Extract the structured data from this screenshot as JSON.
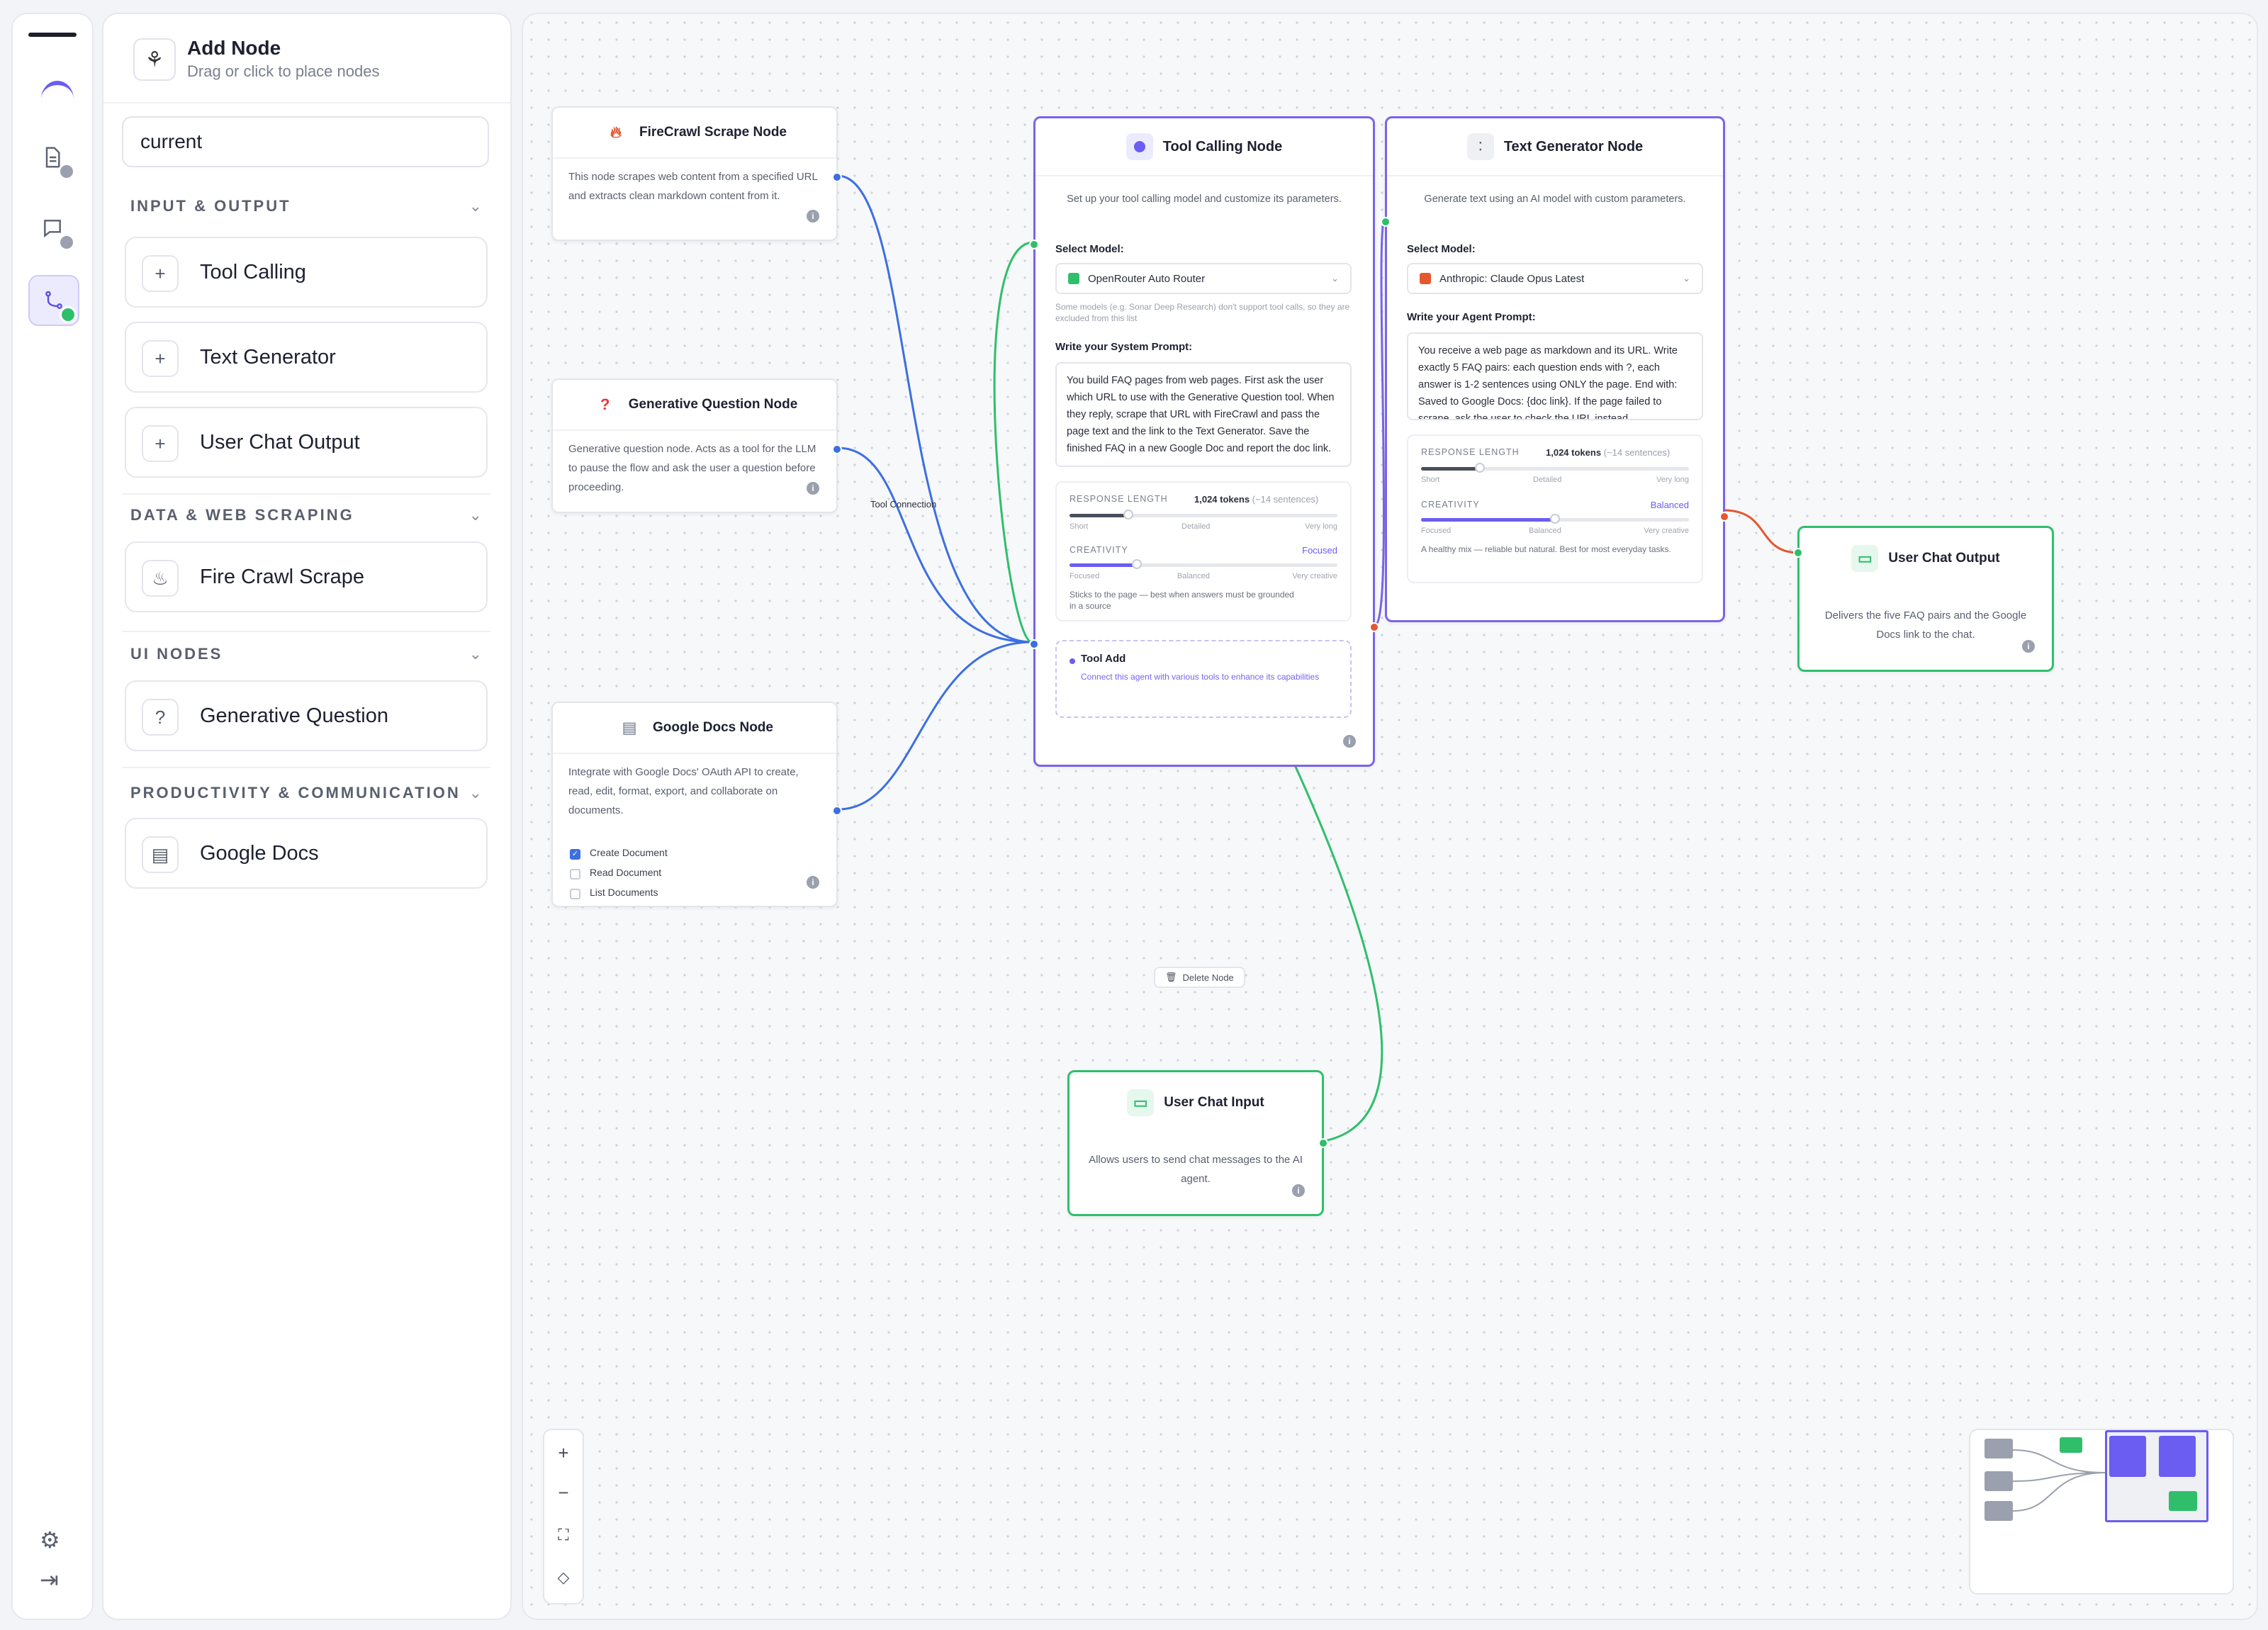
{
  "sidebar_panel": {
    "title": "Add Node",
    "subtitle": "Drag or click to place nodes",
    "search_value": "current",
    "sections": [
      {
        "label": "INPUT & OUTPUT",
        "items": [
          "Tool Calling",
          "Text Generator",
          "User Chat Output"
        ]
      },
      {
        "label": "DATA & WEB SCRAPING",
        "items": [
          "Fire Crawl Scrape"
        ]
      },
      {
        "label": "UI NODES",
        "items": [
          "Generative Question"
        ]
      },
      {
        "label": "PRODUCTIVITY & COMMUNICATION",
        "items": [
          "Google Docs"
        ]
      }
    ]
  },
  "nodes": {
    "firecrawl": {
      "title": "FireCrawl Scrape Node",
      "desc": "This node scrapes web content from a specified URL and extracts clean markdown content from it."
    },
    "genq": {
      "title": "Generative Question Node",
      "desc": "Generative question node. Acts as a tool for the LLM to pause the flow and ask the user a question before proceeding."
    },
    "gdocs": {
      "title": "Google Docs Node",
      "desc": "Integrate with Google Docs' OAuth API to create, read, edit, format, export, and collaborate on documents.",
      "options": [
        {
          "label": "Create Document",
          "checked": true
        },
        {
          "label": "Read Document",
          "checked": false
        },
        {
          "label": "List Documents",
          "checked": false
        }
      ]
    },
    "tool_calling": {
      "title": "Tool Calling Node",
      "desc": "Set up your tool calling model and customize its parameters.",
      "select_label": "Select Model:",
      "model": "OpenRouter Auto Router",
      "model_note": "Some models (e.g. Sonar Deep Research) don't support tool calls, so they are excluded from this list",
      "prompt_label": "Write your System Prompt:",
      "prompt": "You build FAQ pages from web pages. First ask the user which URL to use with the Generative Question tool. When they reply, scrape that URL with FireCrawl and pass the page text and the link to the Text Generator. Save the finished FAQ in a new Google Doc and report the doc link.",
      "response_length_label": "RESPONSE LENGTH",
      "response_length_value": "1,024 tokens",
      "response_length_hint": "(~14 sentences)",
      "response_length_level": 0.22,
      "rl_ticks": [
        "Short",
        "Detailed",
        "Very long"
      ],
      "creativity_label": "CREATIVITY",
      "creativity_value": "Focused",
      "creativity_level": 0.25,
      "cr_ticks": [
        "Focused",
        "Balanced",
        "Very creative"
      ],
      "creativity_note": "Sticks to the page — best when answers must be grounded in a source",
      "tool_add_title": "Tool Add",
      "tool_add_desc": "Connect this agent with various tools to enhance its capabilities"
    },
    "text_gen": {
      "title": "Text Generator Node",
      "desc": "Generate text using an AI model with custom parameters.",
      "select_label": "Select Model:",
      "model": "Anthropic: Claude Opus Latest",
      "prompt_label": "Write your Agent Prompt:",
      "prompt": "You receive a web page as markdown and its URL. Write exactly 5 FAQ pairs: each question ends with ?, each answer is 1-2 sentences using ONLY the page. End with: Saved to Google Docs: {doc link}. If the page failed to scrape, ask the user to check the URL instead.",
      "response_length_label": "RESPONSE LENGTH",
      "response_length_value": "1,024 tokens",
      "response_length_hint": "(~14 sentences)",
      "response_length_level": 0.22,
      "rl_ticks": [
        "Short",
        "Detailed",
        "Very long"
      ],
      "creativity_label": "CREATIVITY",
      "creativity_value": "Balanced",
      "creativity_level": 0.5,
      "cr_ticks": [
        "Focused",
        "Balanced",
        "Very creative"
      ],
      "creativity_note": "A healthy mix — reliable but natural. Best for most everyday tasks."
    },
    "chat_output": {
      "title": "User Chat Output",
      "desc": "Delivers the five FAQ pairs and the Google Docs link to the chat."
    },
    "chat_input": {
      "title": "User Chat Input",
      "desc": "Allows users to send chat messages to the AI agent."
    }
  },
  "edge_label": "Tool Connection",
  "delete_node": "Delete Node",
  "colors": {
    "accent": "#6b5cf2",
    "tool_edge": "#3c6fe0",
    "chat_edge": "#2fbf6b",
    "output_edge": "#e5572f"
  }
}
